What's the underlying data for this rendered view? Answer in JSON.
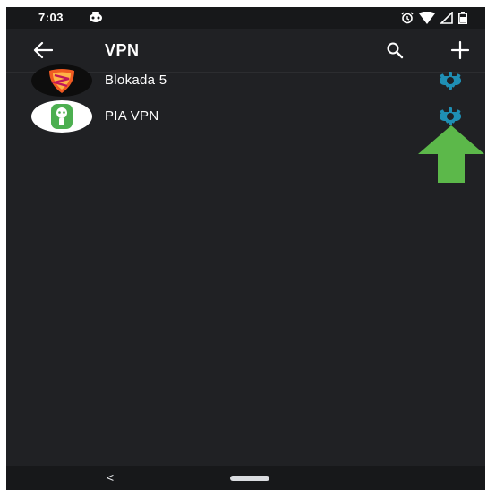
{
  "status_bar": {
    "time": "7:03",
    "icons": [
      "notification-icon",
      "alarm-icon",
      "wifi-icon",
      "signal-icon",
      "battery-icon"
    ]
  },
  "app_bar": {
    "title": "VPN",
    "icons": [
      "back-arrow-icon",
      "search-icon",
      "add-icon"
    ]
  },
  "vpn_list": [
    {
      "label": "Blokada 5",
      "icon": "blokada-shield-icon",
      "action_icon": "gear-icon"
    },
    {
      "label": "PIA VPN",
      "icon": "pia-lock-icon",
      "action_icon": "gear-icon"
    }
  ],
  "nav_bar": {
    "back_glyph": "<",
    "icons": [
      "nav-back-icon",
      "nav-home-pill"
    ]
  },
  "colors": {
    "background": "#202124",
    "status_bar": "#17181a",
    "accent_gear": "#1f8fb5",
    "annotation_arrow": "#5cb84a",
    "pia_green": "#4caf50",
    "blokada_orange": "#f05a22"
  }
}
